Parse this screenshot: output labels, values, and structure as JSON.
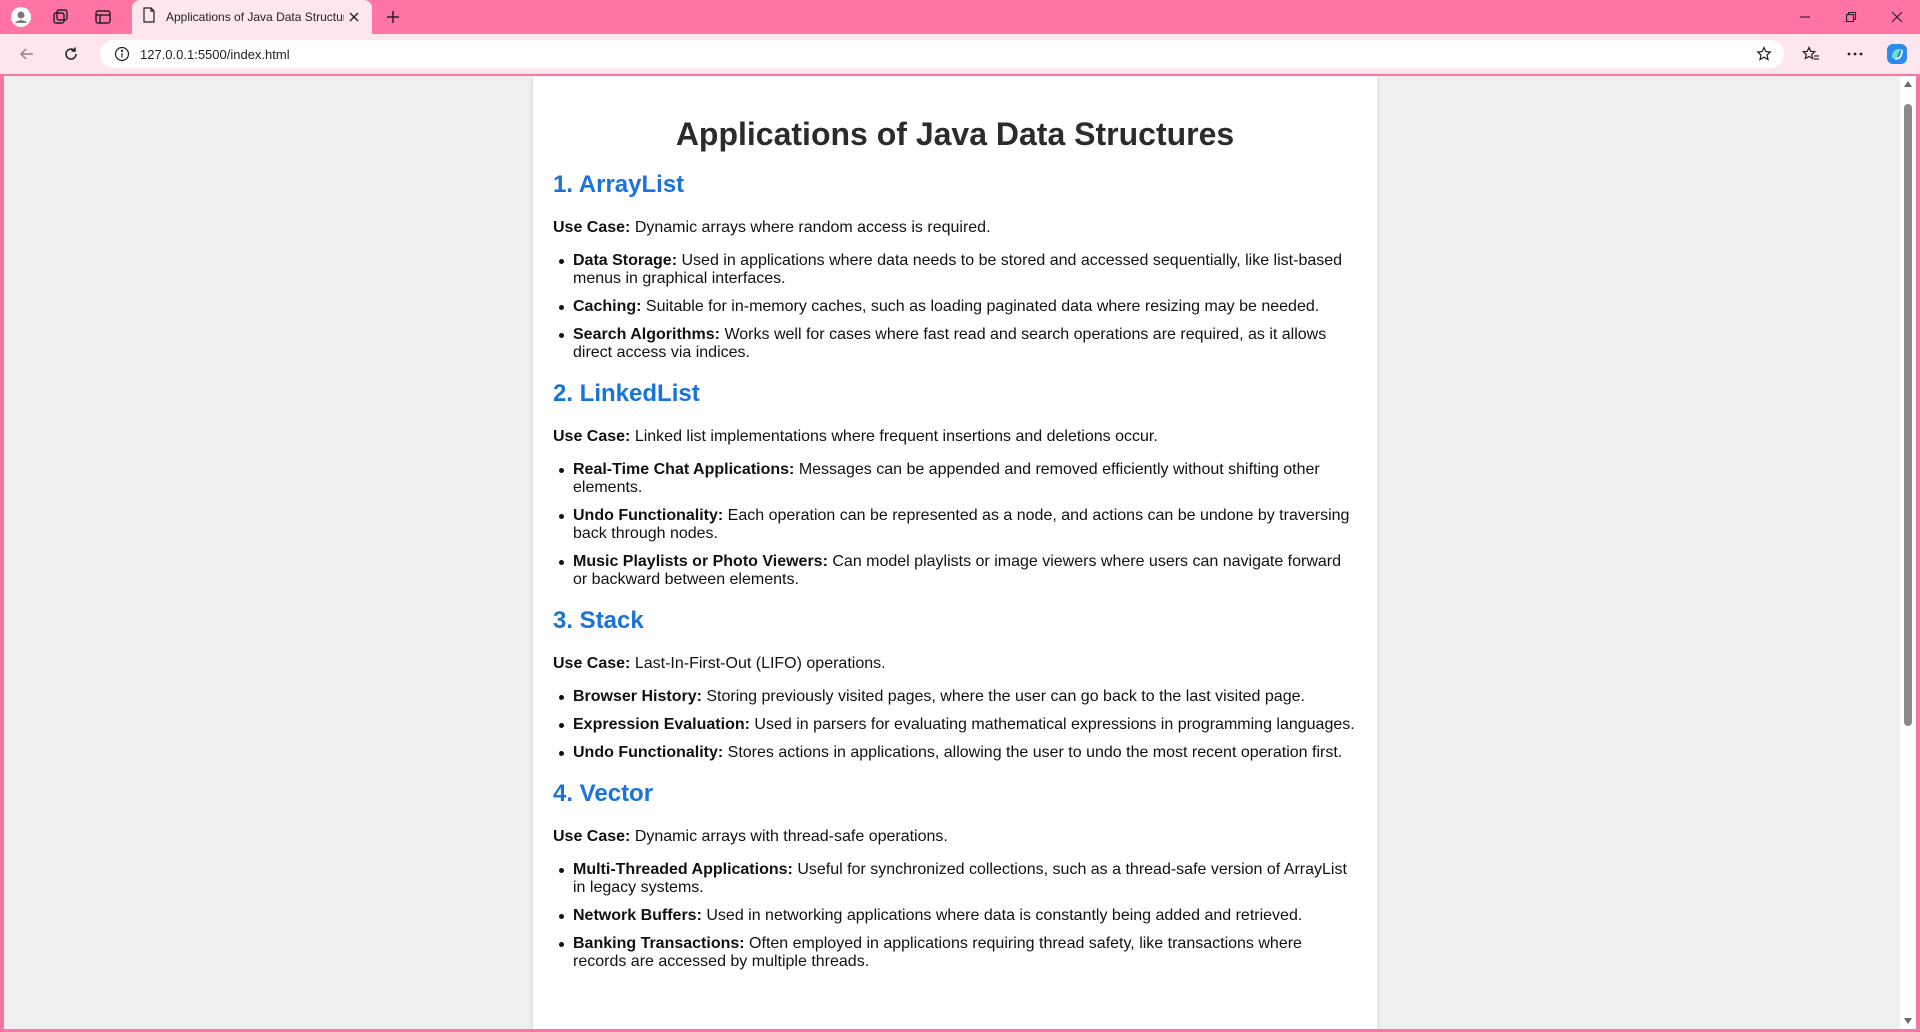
{
  "browser": {
    "tab_title": "Applications of Java Data Structures",
    "url": "127.0.0.1:5500/index.html"
  },
  "page": {
    "title": "Applications of Java Data Structures",
    "use_case_label": "Use Case:",
    "sections": [
      {
        "heading": "1. ArrayList",
        "use_case": "Dynamic arrays where random access is required.",
        "items": [
          {
            "term": "Data Storage:",
            "text": "Used in applications where data needs to be stored and accessed sequentially, like list-based menus in graphical interfaces."
          },
          {
            "term": "Caching:",
            "text": "Suitable for in-memory caches, such as loading paginated data where resizing may be needed."
          },
          {
            "term": "Search Algorithms:",
            "text": "Works well for cases where fast read and search operations are required, as it allows direct access via indices."
          }
        ]
      },
      {
        "heading": "2. LinkedList",
        "use_case": "Linked list implementations where frequent insertions and deletions occur.",
        "items": [
          {
            "term": "Real-Time Chat Applications:",
            "text": "Messages can be appended and removed efficiently without shifting other elements."
          },
          {
            "term": "Undo Functionality:",
            "text": "Each operation can be represented as a node, and actions can be undone by traversing back through nodes."
          },
          {
            "term": "Music Playlists or Photo Viewers:",
            "text": "Can model playlists or image viewers where users can navigate forward or backward between elements."
          }
        ]
      },
      {
        "heading": "3. Stack",
        "use_case": "Last-In-First-Out (LIFO) operations.",
        "items": [
          {
            "term": "Browser History:",
            "text": "Storing previously visited pages, where the user can go back to the last visited page."
          },
          {
            "term": "Expression Evaluation:",
            "text": "Used in parsers for evaluating mathematical expressions in programming languages."
          },
          {
            "term": "Undo Functionality:",
            "text": "Stores actions in applications, allowing the user to undo the most recent operation first."
          }
        ]
      },
      {
        "heading": "4. Vector",
        "use_case": "Dynamic arrays with thread-safe operations.",
        "items": [
          {
            "term": "Multi-Threaded Applications:",
            "text": "Useful for synchronized collections, such as a thread-safe version of ArrayList in legacy systems."
          },
          {
            "term": "Network Buffers:",
            "text": "Used in networking applications where data is constantly being added and retrieved."
          },
          {
            "term": "Banking Transactions:",
            "text": "Often employed in applications requiring thread safety, like transactions where records are accessed by multiple threads."
          }
        ]
      }
    ]
  },
  "colors": {
    "chrome": "#ff74a4",
    "toolbar": "#fde6ee",
    "heading_blue": "#1a73d9",
    "page_bg": "#f0f0f0"
  },
  "icons": {
    "profile": "profile-icon",
    "workspaces": "workspaces-icon",
    "tab_actions": "tab-actions-icon",
    "page": "page-icon",
    "close": "close-icon",
    "new_tab": "plus-icon",
    "back": "back-arrow-icon",
    "refresh": "refresh-icon",
    "info": "info-icon",
    "favorite": "star-icon",
    "favorites": "favorites-icon",
    "more": "more-icon",
    "copilot": "copilot-icon"
  }
}
